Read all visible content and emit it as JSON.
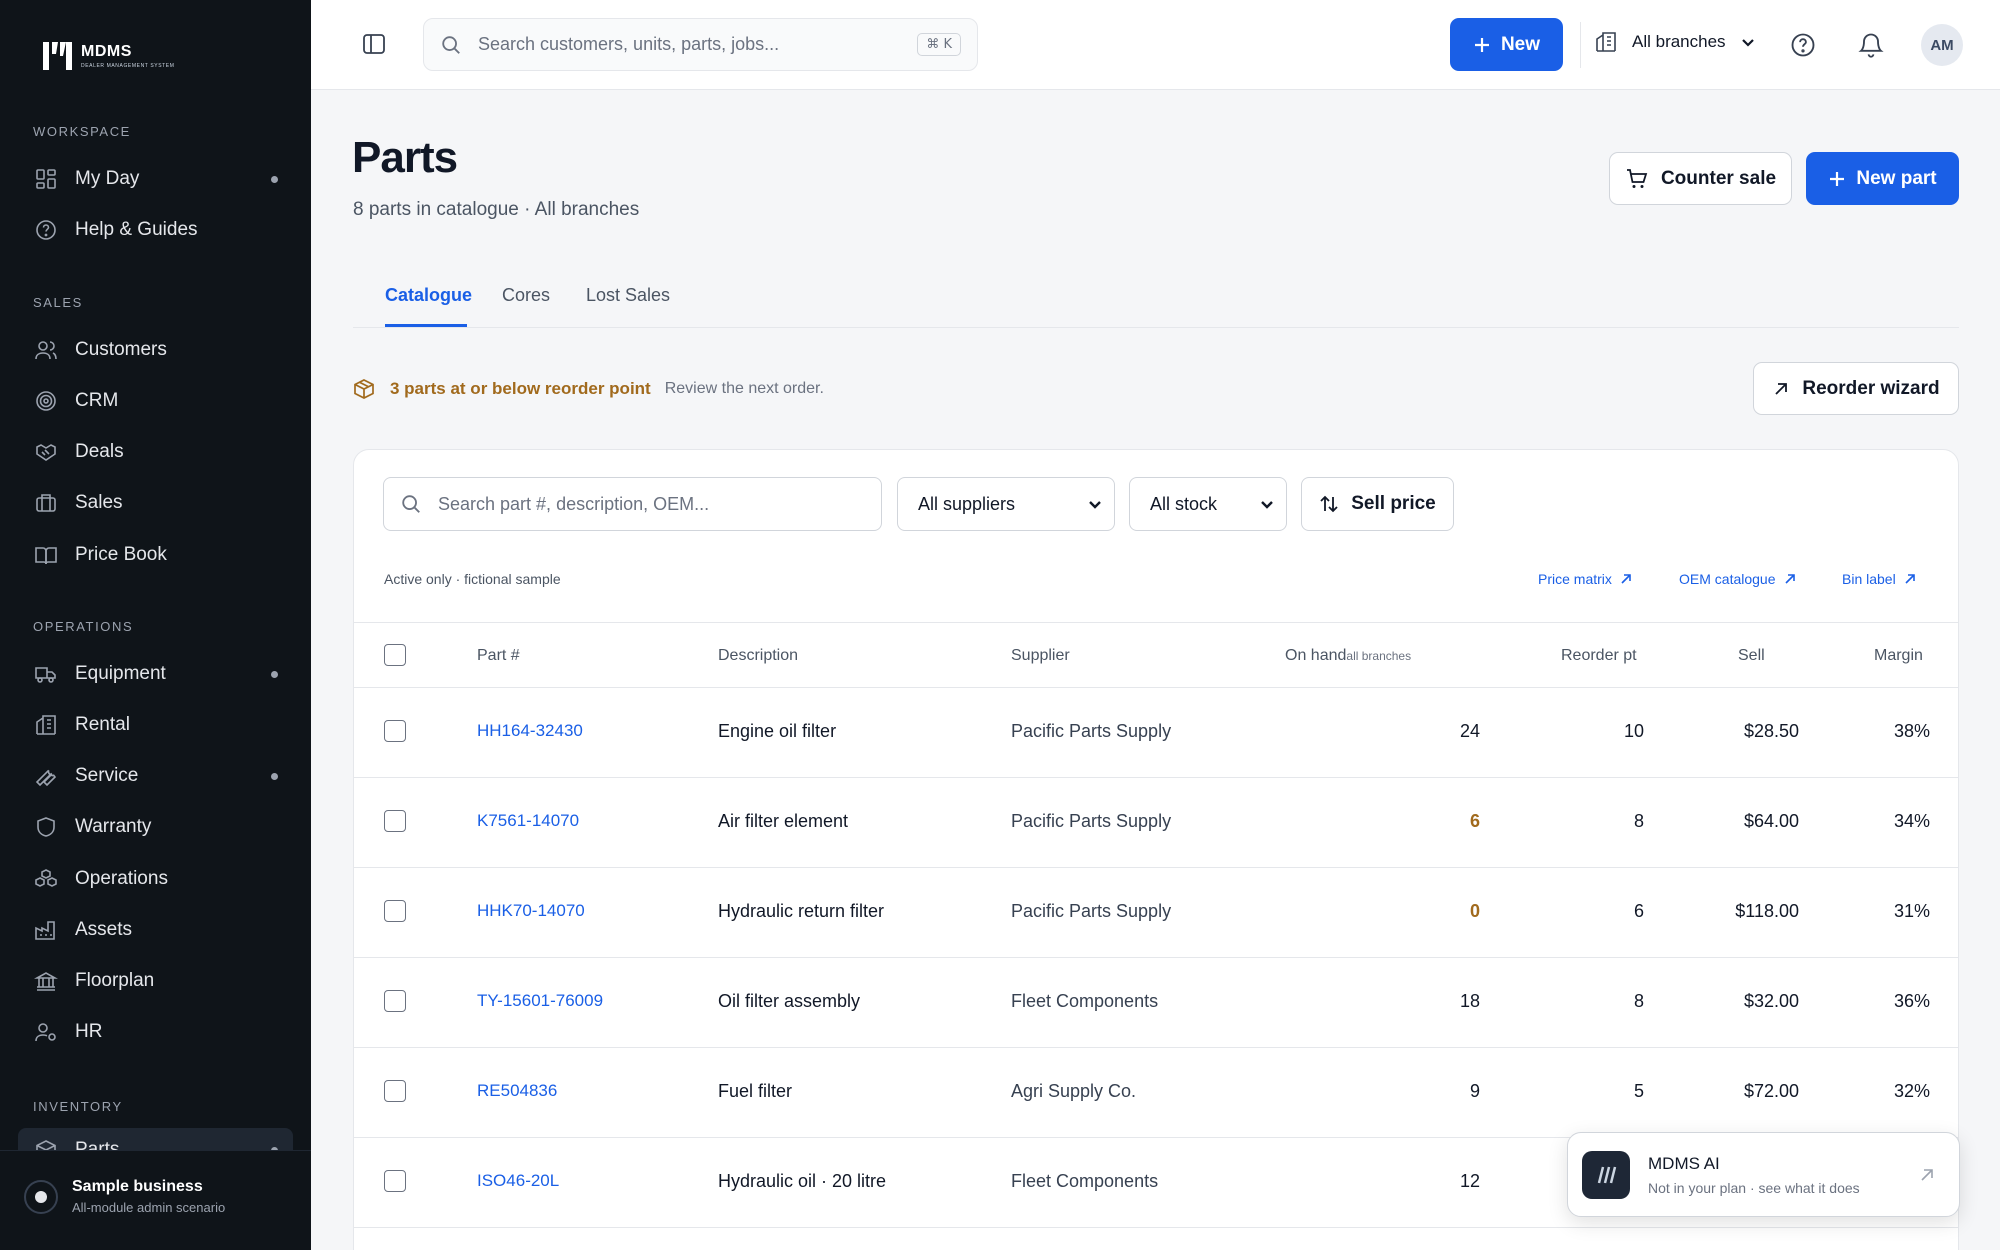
{
  "app": {
    "logo_name": "MDMS",
    "logo_sub": "DEALER MANAGEMENT SYSTEM"
  },
  "sidebar": {
    "sections": {
      "workspace": "WORKSPACE",
      "sales": "SALES",
      "operations": "OPERATIONS",
      "inventory": "INVENTORY"
    },
    "items": [
      {
        "label": "My Day",
        "icon": "grid-icon",
        "dot": true
      },
      {
        "label": "Help & Guides",
        "icon": "help-circle-icon",
        "dot": false
      },
      {
        "label": "Customers",
        "icon": "users-icon",
        "dot": false
      },
      {
        "label": "CRM",
        "icon": "target-icon",
        "dot": false
      },
      {
        "label": "Deals",
        "icon": "handshake-icon",
        "dot": false
      },
      {
        "label": "Sales",
        "icon": "briefcase-icon",
        "dot": false
      },
      {
        "label": "Price Book",
        "icon": "book-icon",
        "dot": false
      },
      {
        "label": "Equipment",
        "icon": "truck-icon",
        "dot": true
      },
      {
        "label": "Rental",
        "icon": "building-icon",
        "dot": false
      },
      {
        "label": "Service",
        "icon": "wrench-icon",
        "dot": true
      },
      {
        "label": "Warranty",
        "icon": "shield-icon",
        "dot": false
      },
      {
        "label": "Operations",
        "icon": "boxes-icon",
        "dot": false
      },
      {
        "label": "Assets",
        "icon": "factory-icon",
        "dot": false
      },
      {
        "label": "Floorplan",
        "icon": "bank-icon",
        "dot": false
      },
      {
        "label": "HR",
        "icon": "user-cog-icon",
        "dot": false
      },
      {
        "label": "Parts",
        "icon": "package-icon",
        "dot": true,
        "active": true
      }
    ],
    "business": {
      "name": "Sample business",
      "sub": "All-module admin scenario"
    }
  },
  "topbar": {
    "search_placeholder": "Search customers, units, parts, jobs...",
    "search_shortcut": "⌘ K",
    "new_label": "New",
    "branch_label": "All branches",
    "avatar_initials": "AM"
  },
  "page": {
    "title": "Parts",
    "subtitle": "8 parts in catalogue · All branches",
    "counter_sale_label": "Counter sale",
    "new_part_label": "New part",
    "tabs": [
      "Catalogue",
      "Cores",
      "Lost Sales"
    ],
    "active_tab": "Catalogue",
    "alert_strong": "3 parts at or below reorder point",
    "alert_sub": "Review the next order.",
    "reorder_wizard_label": "Reorder wizard"
  },
  "catalogue": {
    "search_placeholder": "Search part #, description, OEM...",
    "supplier_filter": "All suppliers",
    "stock_filter": "All stock",
    "sort_label": "Sell price",
    "note": "Active only · fictional sample",
    "links": [
      "Price matrix",
      "OEM catalogue",
      "Bin label"
    ],
    "columns": {
      "part": "Part #",
      "description": "Description",
      "supplier": "Supplier",
      "onhand": "On hand",
      "onhand_sub": "all branches",
      "reorder": "Reorder pt",
      "sell": "Sell",
      "margin": "Margin"
    },
    "rows": [
      {
        "part": "HH164-32430",
        "description": "Engine oil filter",
        "supplier": "Pacific Parts Supply",
        "onhand": "24",
        "low": false,
        "reorder": "10",
        "sell": "$28.50",
        "margin": "38%"
      },
      {
        "part": "K7561-14070",
        "description": "Air filter element",
        "supplier": "Pacific Parts Supply",
        "onhand": "6",
        "low": true,
        "reorder": "8",
        "sell": "$64.00",
        "margin": "34%"
      },
      {
        "part": "HHK70-14070",
        "description": "Hydraulic return filter",
        "supplier": "Pacific Parts Supply",
        "onhand": "0",
        "low": true,
        "reorder": "6",
        "sell": "$118.00",
        "margin": "31%"
      },
      {
        "part": "TY-15601-76009",
        "description": "Oil filter assembly",
        "supplier": "Fleet Components",
        "onhand": "18",
        "low": false,
        "reorder": "8",
        "sell": "$32.00",
        "margin": "36%"
      },
      {
        "part": "RE504836",
        "description": "Fuel filter",
        "supplier": "Agri Supply Co.",
        "onhand": "9",
        "low": false,
        "reorder": "5",
        "sell": "$72.00",
        "margin": "32%"
      },
      {
        "part": "ISO46-20L",
        "description": "Hydraulic oil · 20 litre",
        "supplier": "Fleet Components",
        "onhand": "12",
        "low": false,
        "reorder": "",
        "sell": "",
        "margin": ""
      }
    ]
  },
  "ai_panel": {
    "title": "MDMS AI",
    "sub": "Not in your plan · see what it does"
  },
  "colors": {
    "accent": "#1a5fe6",
    "sidebar_bg": "#0f1419",
    "warning": "#a16a1d"
  }
}
